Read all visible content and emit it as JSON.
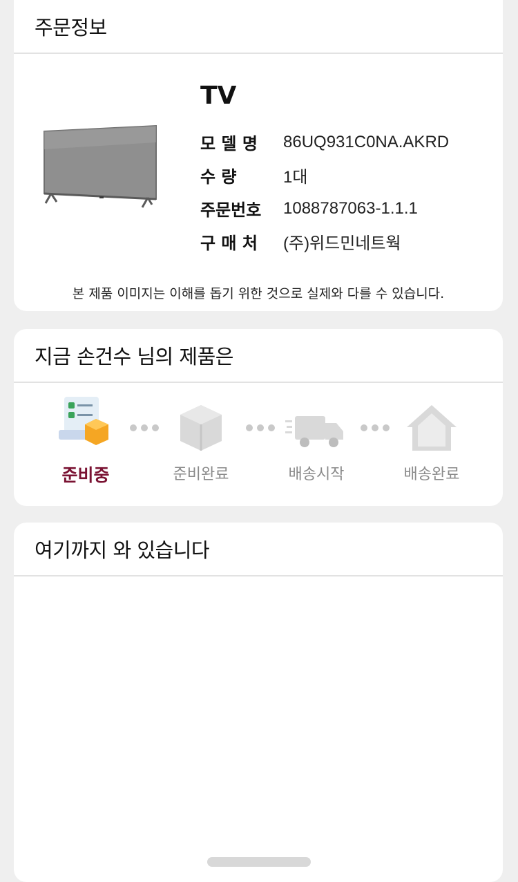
{
  "order": {
    "header": "주문정보",
    "product_name": "TV",
    "rows": [
      {
        "label": "모 델 명",
        "value": "86UQ931C0NA.AKRD"
      },
      {
        "label": "수 량",
        "value": "1대"
      },
      {
        "label": "주문번호",
        "value": "1088787063-1.1.1"
      },
      {
        "label": "구 매 처",
        "value": "(주)위드민네트웍"
      }
    ],
    "disclaimer": "본 제품 이미지는 이해를 돕기 위한 것으로 실제와 다를 수 있습니다."
  },
  "status": {
    "header": "지금 손건수 님의 제품은",
    "steps": [
      {
        "label": "준비중",
        "icon": "checklist-box-icon",
        "active": true
      },
      {
        "label": "준비완료",
        "icon": "box-icon",
        "active": false
      },
      {
        "label": "배송시작",
        "icon": "delivery-truck-icon",
        "active": false
      },
      {
        "label": "배송완료",
        "icon": "house-icon",
        "active": false
      }
    ],
    "accent_color": "#7a1232"
  },
  "location": {
    "header": "여기까지 와 있습니다"
  }
}
